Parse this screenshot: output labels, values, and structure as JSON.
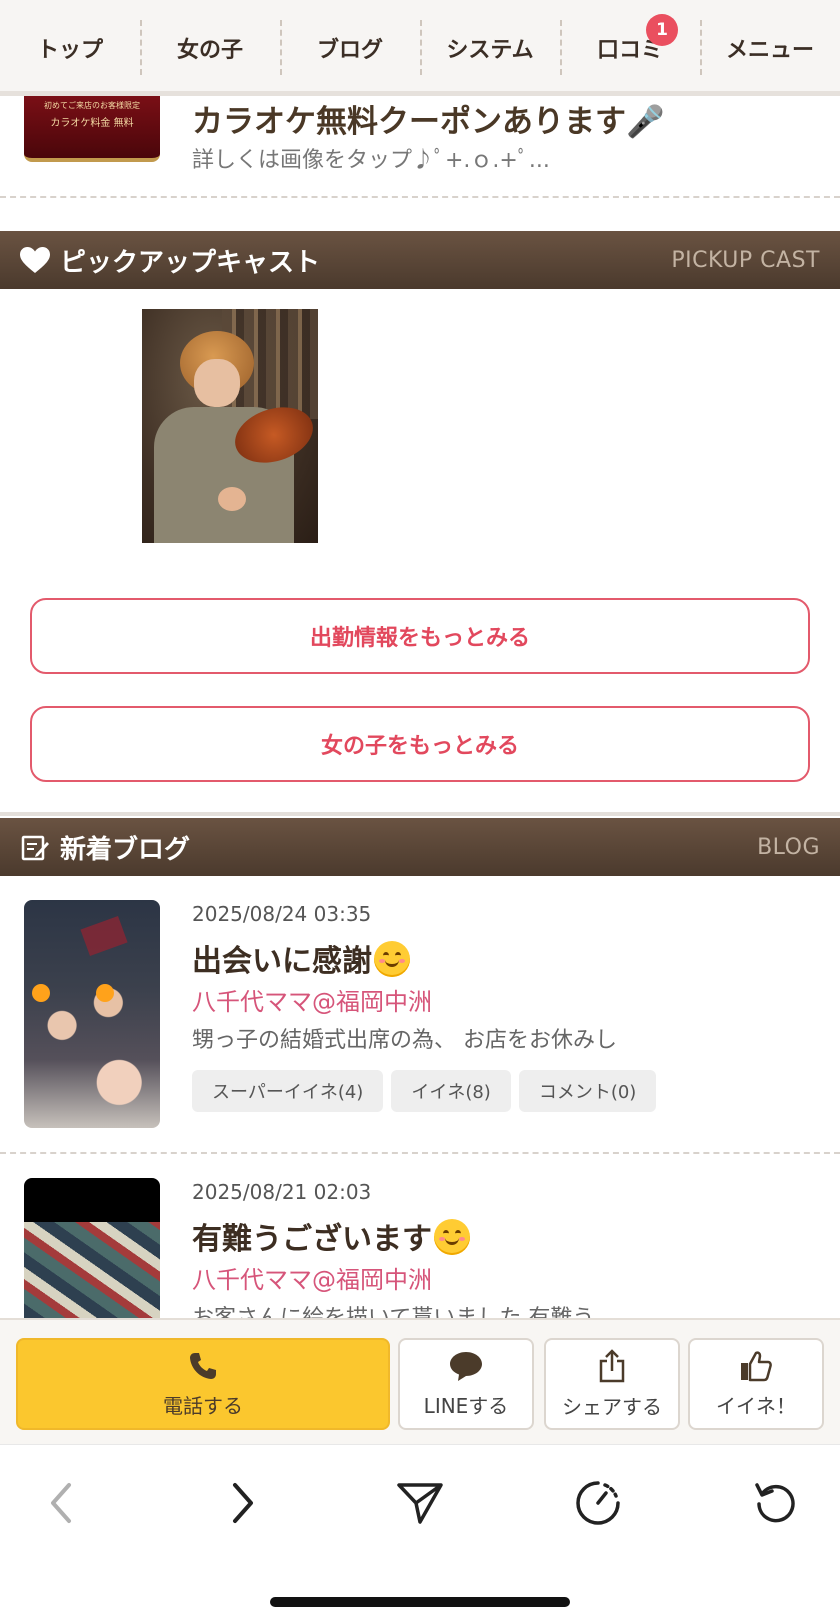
{
  "nav": {
    "tabs": [
      {
        "label": "トップ"
      },
      {
        "label": "女の子"
      },
      {
        "label": "ブログ"
      },
      {
        "label": "システム"
      },
      {
        "label": "口コミ",
        "badge": "1"
      },
      {
        "label": "メニュー"
      }
    ]
  },
  "coupon": {
    "thumb_line1": "初めてご来店のお客様限定",
    "thumb_line2": "カラオケ料金 無料",
    "title": "カラオケ無料クーポンあります🎤",
    "desc": "詳しくは画像をタップ♪ﾟ+.ｏ.+ﾟ..."
  },
  "pickup": {
    "heading": "ピックアップキャスト",
    "heading_en": "PICKUP CAST",
    "more_attendance": "出勤情報をもっとみる",
    "more_girls": "女の子をもっとみる"
  },
  "blog": {
    "heading": "新着ブログ",
    "heading_en": "BLOG",
    "items": [
      {
        "date": "2025/08/24 03:35",
        "title": "出会いに感謝",
        "author": "八千代ママ@福岡中洲",
        "excerpt": "甥っ子の結婚式出席の為、 お店をお休みし",
        "chips": [
          "スーパーイイネ(4)",
          "イイネ(8)",
          "コメント(0)"
        ]
      },
      {
        "date": "2025/08/21 02:03",
        "title": "有難うございます",
        "author": "八千代ママ@福岡中洲",
        "excerpt": "お客さんに絵を描いて貰いました 有難う"
      }
    ]
  },
  "actions": {
    "call": "電話する",
    "line": "LINEする",
    "share": "シェアする",
    "like": "イイネ！"
  },
  "colors": {
    "accent_pink": "#e2485d",
    "header_brown": "#5a4636",
    "call_yellow": "#fbc72e",
    "badge_red": "#ea4f5f"
  }
}
